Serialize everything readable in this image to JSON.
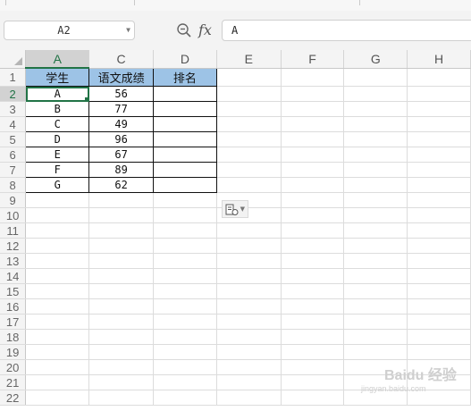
{
  "formula_bar": {
    "name_box": "A2",
    "fx_label": "fx",
    "formula_value": "A"
  },
  "sheet": {
    "columns": [
      "A",
      "C",
      "D",
      "E",
      "F",
      "G",
      "H"
    ],
    "active_column": "A",
    "active_row": 2,
    "rows": [
      {
        "n": "1",
        "cells": [
          "学生",
          "语文成绩",
          "排名"
        ]
      },
      {
        "n": "2",
        "cells": [
          "A",
          "56",
          ""
        ]
      },
      {
        "n": "3",
        "cells": [
          "B",
          "77",
          ""
        ]
      },
      {
        "n": "4",
        "cells": [
          "C",
          "49",
          ""
        ]
      },
      {
        "n": "5",
        "cells": [
          "D",
          "96",
          ""
        ]
      },
      {
        "n": "6",
        "cells": [
          "E",
          "67",
          ""
        ]
      },
      {
        "n": "7",
        "cells": [
          "F",
          "89",
          ""
        ]
      },
      {
        "n": "8",
        "cells": [
          "G",
          "62",
          ""
        ]
      },
      {
        "n": "9",
        "cells": [
          "",
          "",
          ""
        ]
      },
      {
        "n": "10",
        "cells": [
          "",
          "",
          ""
        ]
      },
      {
        "n": "11",
        "cells": [
          "",
          "",
          ""
        ]
      },
      {
        "n": "12",
        "cells": [
          "",
          "",
          ""
        ]
      },
      {
        "n": "13",
        "cells": [
          "",
          "",
          ""
        ]
      },
      {
        "n": "14",
        "cells": [
          "",
          "",
          ""
        ]
      },
      {
        "n": "15",
        "cells": [
          "",
          "",
          ""
        ]
      },
      {
        "n": "16",
        "cells": [
          "",
          "",
          ""
        ]
      },
      {
        "n": "17",
        "cells": [
          "",
          "",
          ""
        ]
      },
      {
        "n": "18",
        "cells": [
          "",
          "",
          ""
        ]
      },
      {
        "n": "19",
        "cells": [
          "",
          "",
          ""
        ]
      },
      {
        "n": "20",
        "cells": [
          "",
          "",
          ""
        ]
      },
      {
        "n": "21",
        "cells": [
          "",
          "",
          ""
        ]
      },
      {
        "n": "22",
        "cells": [
          "",
          "",
          ""
        ]
      }
    ]
  },
  "colors": {
    "accent": "#217346",
    "header_fill": "#9dc3e6"
  },
  "icons": {
    "zoom": "zoom-icon",
    "fx": "fx-icon",
    "paste_options": "paste-options-icon"
  },
  "watermark": {
    "brand": "Baidu 经验",
    "url": "jingyan.baidu.com"
  }
}
